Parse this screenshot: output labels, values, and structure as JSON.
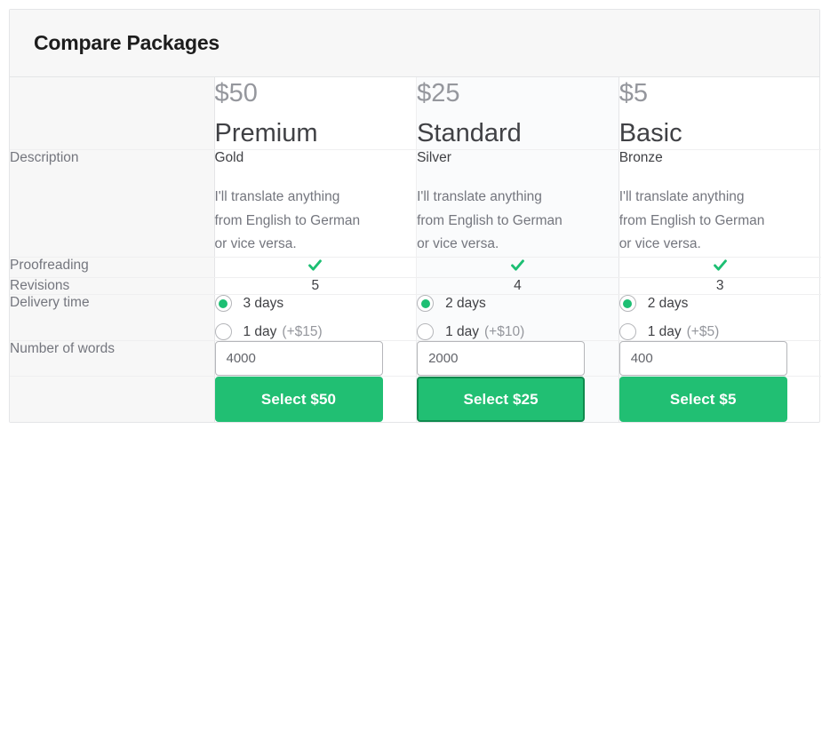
{
  "header": {
    "title": "Compare Packages"
  },
  "columns": [
    {
      "price": "$50",
      "name": "Premium",
      "highlight": false
    },
    {
      "price": "$25",
      "name": "Standard",
      "highlight": true
    },
    {
      "price": "$5",
      "name": "Basic",
      "highlight": false
    }
  ],
  "rows": {
    "description": {
      "label": "Description",
      "values": [
        {
          "title": "Gold",
          "body": "I'll translate anything from English to German or vice versa."
        },
        {
          "title": "Silver",
          "body": "I'll translate anything from English to German or vice versa."
        },
        {
          "title": "Bronze",
          "body": "I'll translate anything from English to German or vice versa."
        }
      ]
    },
    "proofreading": {
      "label": "Proofreading",
      "values": [
        "check-icon",
        "check-icon",
        "check-icon"
      ]
    },
    "revisions": {
      "label": "Revisions",
      "values": [
        "5",
        "4",
        "3"
      ]
    },
    "delivery": {
      "label": "Delivery time",
      "columns": [
        {
          "options": [
            {
              "label": "3 days",
              "extra": "",
              "selected": true
            },
            {
              "label": "1 day",
              "extra": "(+$15)",
              "selected": false
            }
          ]
        },
        {
          "options": [
            {
              "label": "2 days",
              "extra": "",
              "selected": true
            },
            {
              "label": "1 day",
              "extra": "(+$10)",
              "selected": false
            }
          ]
        },
        {
          "options": [
            {
              "label": "2 days",
              "extra": "",
              "selected": true
            },
            {
              "label": "1 day",
              "extra": "(+$5)",
              "selected": false
            }
          ]
        }
      ]
    },
    "words": {
      "label": "Number of words",
      "values": [
        "4000",
        "2000",
        "400"
      ]
    },
    "action": {
      "label": "",
      "buttons": [
        {
          "label": "Select $50",
          "focused": false
        },
        {
          "label": "Select $25",
          "focused": true
        },
        {
          "label": "Select $5",
          "focused": false
        }
      ]
    }
  },
  "colors": {
    "accent_green": "#21bf73",
    "accent_green_dark": "#108a4e",
    "label_bg": "#f7f7f7",
    "highlight_bg": "#fafbfc",
    "border": "#e4e5e7",
    "text_primary": "#404145",
    "text_muted": "#74767e"
  }
}
